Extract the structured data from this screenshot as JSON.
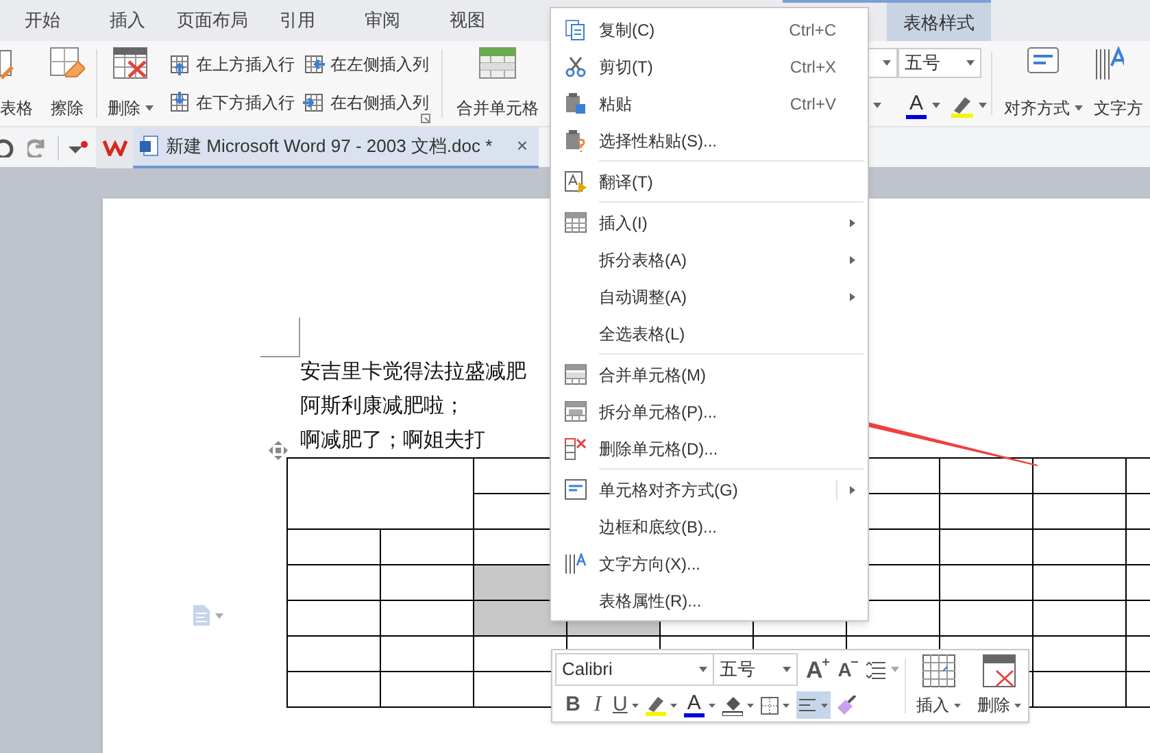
{
  "tabs": [
    {
      "label": "开始",
      "selected": false
    },
    {
      "label": "插入",
      "selected": false
    },
    {
      "label": "页面布局",
      "selected": false
    },
    {
      "label": "引用",
      "selected": false
    },
    {
      "label": "审阅",
      "selected": false
    },
    {
      "label": "视图",
      "selected": false
    },
    {
      "label": "表格样式",
      "selected": true
    }
  ],
  "ribbon": {
    "draw_table": "表格",
    "eraser": "擦除",
    "delete": "删除",
    "insert_row_above": "在上方插入行",
    "insert_row_below": "在下方插入行",
    "insert_col_left": "在左侧插入列",
    "insert_col_right": "在右侧插入列",
    "merge_cells": "合并单元格",
    "font_size": "五号",
    "font_color": "A",
    "align": "对齐方式",
    "text_direction": "文字方"
  },
  "doc_tab": {
    "title": "新建 Microsoft Word 97 - 2003 文档.doc *",
    "close": "×"
  },
  "document": {
    "lines": [
      "安吉里卡觉得法拉盛减肥",
      "阿斯利康减肥啦；",
      "啊减肥了；啊姐夫打"
    ]
  },
  "table": {
    "rows": [
      {
        "cells": [
          {
            "selected": false
          },
          {
            "selected": false
          },
          {},
          {},
          {},
          {
            "selected": false
          },
          {
            "selected": false
          },
          {
            "selected": false
          },
          {
            "selected": false
          }
        ]
      },
      {
        "cells": [
          {
            "selected": false
          },
          {},
          {},
          {},
          {
            "selected": false
          },
          {
            "selected": false
          },
          {
            "selected": false
          },
          {
            "selected": false
          }
        ]
      },
      {
        "cells": [
          {
            "selected": false
          },
          {
            "selected": false
          },
          {
            "selected": false
          },
          {},
          {},
          {},
          {
            "selected": false
          },
          {
            "selected": false
          },
          {
            "selected": false
          },
          {
            "selected": false
          }
        ]
      },
      {
        "cells": [
          {
            "selected": false
          },
          {
            "selected": false
          },
          {
            "selected": true
          },
          {},
          {},
          {},
          {
            "selected": false
          },
          {
            "selected": false
          },
          {
            "selected": false
          },
          {
            "selected": false
          }
        ]
      },
      {
        "cells": [
          {
            "selected": false
          },
          {
            "selected": false
          },
          {
            "selected": true
          },
          {
            "selected": true
          },
          {
            "selected": false
          },
          {
            "selected": false
          },
          {
            "selected": false
          },
          {
            "selected": false
          },
          {
            "selected": false
          },
          {
            "selected": false
          }
        ]
      },
      {
        "cells": [
          {
            "selected": false
          },
          {
            "selected": false
          },
          {
            "selected": false
          },
          {
            "selected": false
          },
          {
            "selected": false
          },
          {
            "selected": false
          },
          {
            "selected": false
          },
          {
            "selected": false
          },
          {
            "selected": false
          },
          {
            "selected": false
          }
        ]
      },
      {
        "cells": [
          {
            "selected": false
          },
          {
            "selected": false
          },
          {
            "selected": false
          },
          {},
          {},
          {},
          {},
          {},
          {
            "selected": false
          },
          {
            "selected": false
          }
        ]
      }
    ]
  },
  "context_menu": {
    "items": [
      {
        "kind": "item",
        "label": "复制(C)",
        "shortcut": "Ctrl+C",
        "submenu": false
      },
      {
        "kind": "item",
        "label": "剪切(T)",
        "shortcut": "Ctrl+X",
        "submenu": false
      },
      {
        "kind": "item",
        "label": "粘贴",
        "shortcut": "Ctrl+V",
        "submenu": false
      },
      {
        "kind": "item",
        "label": "选择性粘贴(S)...",
        "submenu": false
      },
      {
        "kind": "separator"
      },
      {
        "kind": "item",
        "label": "翻译(T)",
        "submenu": false
      },
      {
        "kind": "separator"
      },
      {
        "kind": "item",
        "label": "插入(I)",
        "submenu": true
      },
      {
        "kind": "item",
        "label": "拆分表格(A)",
        "submenu": true
      },
      {
        "kind": "item",
        "label": "自动调整(A)",
        "submenu": true
      },
      {
        "kind": "item",
        "label": "全选表格(L)",
        "submenu": false
      },
      {
        "kind": "separator"
      },
      {
        "kind": "item",
        "label": "合并单元格(M)",
        "submenu": false
      },
      {
        "kind": "item",
        "label": "拆分单元格(P)...",
        "submenu": false
      },
      {
        "kind": "item",
        "label": "删除单元格(D)...",
        "submenu": false
      },
      {
        "kind": "separator"
      },
      {
        "kind": "item",
        "label": "单元格对齐方式(G)",
        "submenu": true
      },
      {
        "kind": "item",
        "label": "边框和底纹(B)...",
        "submenu": false
      },
      {
        "kind": "item",
        "label": "文字方向(X)...",
        "submenu": false
      },
      {
        "kind": "item",
        "label": "表格属性(R)...",
        "submenu": false
      }
    ]
  },
  "mini_toolbar": {
    "font": "Calibri",
    "size": "五号",
    "grow": "A",
    "shrink": "A",
    "bold": "B",
    "italic": "I",
    "underline": "U",
    "font_color": "A",
    "insert": "插入",
    "delete": "删除"
  }
}
